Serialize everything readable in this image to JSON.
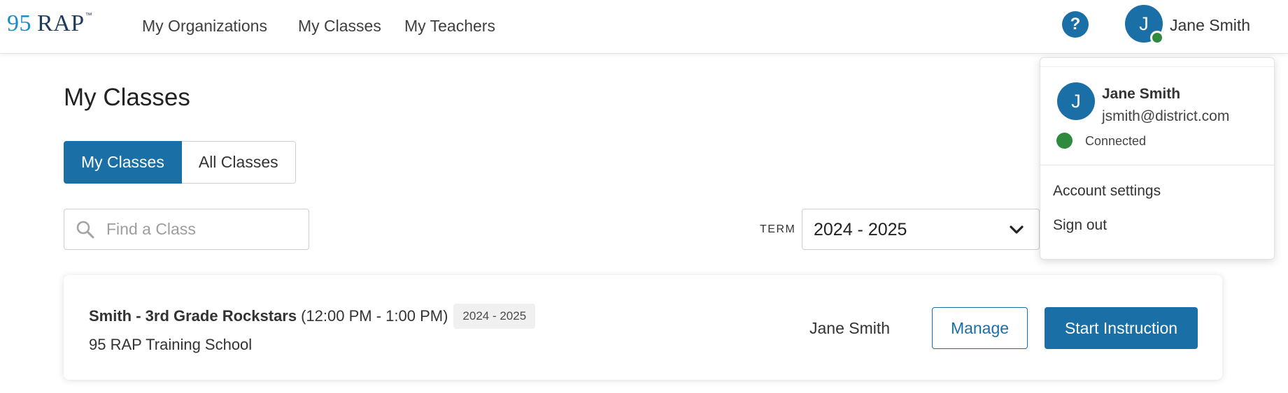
{
  "app": {
    "logo_number": "95",
    "logo_text": "RAP",
    "logo_tm": "™"
  },
  "nav": {
    "links": [
      "My Organizations",
      "My Classes",
      "My Teachers"
    ],
    "help_icon_glyph": "?",
    "help_icon": "question-circle-icon",
    "user_initial": "J",
    "user_name": "Jane Smith"
  },
  "page": {
    "title": "My Classes",
    "toggle": {
      "options": [
        "My Classes",
        "All Classes"
      ],
      "selected": "My Classes"
    },
    "search": {
      "placeholder": "Find a Class",
      "value": "",
      "icon": "search-icon"
    },
    "term": {
      "label": "TERM",
      "selected": "2024 - 2025",
      "icon": "chevron-down-icon"
    }
  },
  "classes": [
    {
      "name": "Smith - 3rd Grade Rockstars",
      "time": "(12:00 PM - 1:00 PM)",
      "term_badge": "2024 - 2025",
      "school": "95 RAP Training School",
      "teacher": "Jane Smith",
      "manage_label": "Manage",
      "start_label": "Start Instruction"
    }
  ],
  "user_menu": {
    "initial": "J",
    "name": "Jane Smith",
    "email": "jsmith@district.com",
    "status": "Connected",
    "items": [
      "Account settings",
      "Sign out"
    ]
  },
  "colors": {
    "primary": "#1a6fa6",
    "logo_accent": "#1a8cc8",
    "logo_dark": "#1f3d5a",
    "status_green": "#2e8b3e"
  }
}
